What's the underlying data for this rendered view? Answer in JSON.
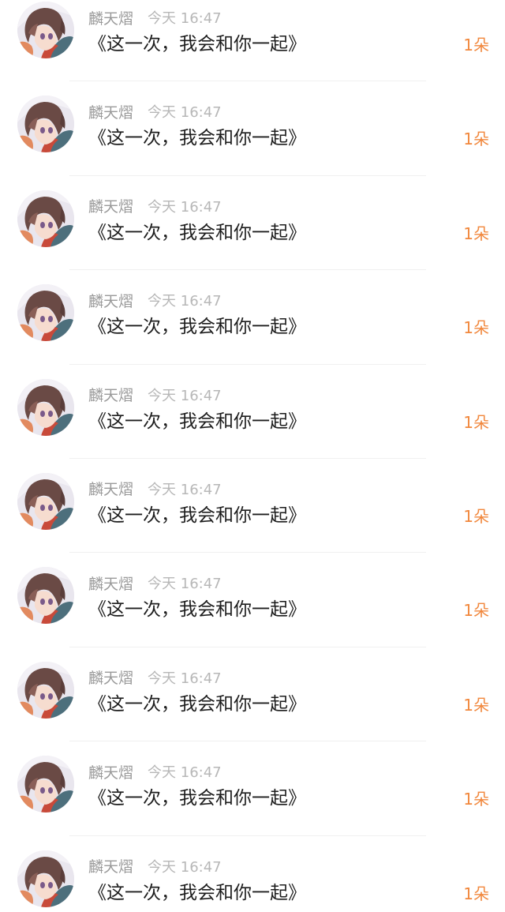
{
  "messages": [
    {
      "username": "麟天熠",
      "time": "今天 16:47",
      "text": "《这一次，我会和你一起》",
      "count": "1朵"
    },
    {
      "username": "麟天熠",
      "time": "今天 16:47",
      "text": "《这一次，我会和你一起》",
      "count": "1朵"
    },
    {
      "username": "麟天熠",
      "time": "今天 16:47",
      "text": "《这一次，我会和你一起》",
      "count": "1朵"
    },
    {
      "username": "麟天熠",
      "time": "今天 16:47",
      "text": "《这一次，我会和你一起》",
      "count": "1朵"
    },
    {
      "username": "麟天熠",
      "time": "今天 16:47",
      "text": "《这一次，我会和你一起》",
      "count": "1朵"
    },
    {
      "username": "麟天熠",
      "time": "今天 16:47",
      "text": "《这一次，我会和你一起》",
      "count": "1朵"
    },
    {
      "username": "麟天熠",
      "time": "今天 16:47",
      "text": "《这一次，我会和你一起》",
      "count": "1朵"
    },
    {
      "username": "麟天熠",
      "time": "今天 16:47",
      "text": "《这一次，我会和你一起》",
      "count": "1朵"
    },
    {
      "username": "麟天熠",
      "time": "今天 16:47",
      "text": "《这一次，我会和你一起》",
      "count": "1朵"
    },
    {
      "username": "麟天熠",
      "time": "今天 16:47",
      "text": "《这一次，我会和你一起》",
      "count": "1朵"
    }
  ],
  "colors": {
    "count": "#f1873c",
    "username": "#9a9a9a",
    "time": "#b7b7b7",
    "message": "#1d1d1d"
  },
  "icons": {
    "avatar": "anime-character-avatar"
  }
}
